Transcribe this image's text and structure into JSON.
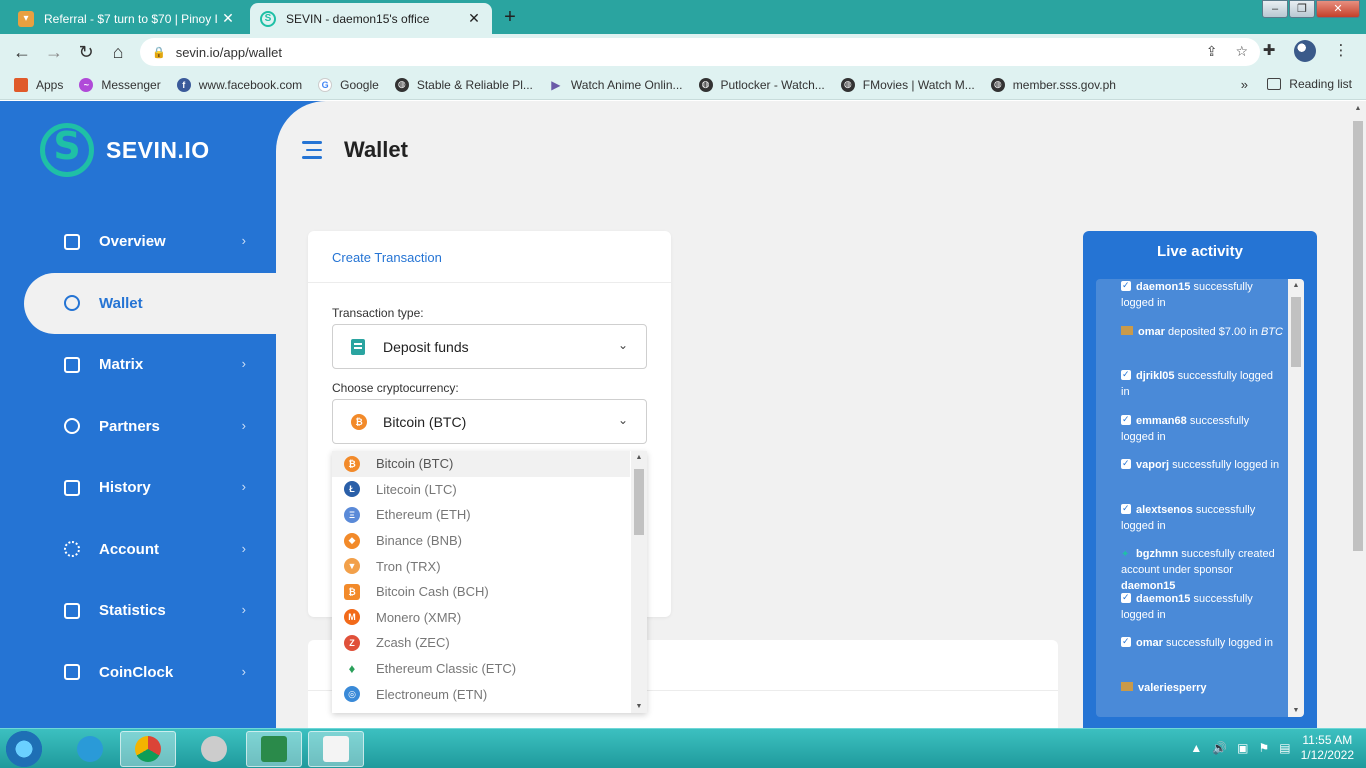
{
  "browser": {
    "tabs": [
      {
        "title": "Referral - $7 turn to $70 | Pinoy I",
        "active": false
      },
      {
        "title": "SEVIN - daemon15's office",
        "active": true
      }
    ],
    "new_tab": "+",
    "url": "sevin.io/app/wallet",
    "bookmarks": [
      {
        "label": "Apps",
        "icon": "apps-grid-icon",
        "color": "#e05a2a"
      },
      {
        "label": "Messenger",
        "icon": "messenger-icon",
        "color": "#b04ad8"
      },
      {
        "label": "www.facebook.com",
        "icon": "facebook-icon",
        "color": "#3a5a9a"
      },
      {
        "label": "Google",
        "icon": "google-icon",
        "color": "#4285f4"
      },
      {
        "label": "Stable & Reliable Pl...",
        "icon": "globe-icon",
        "color": "#333333"
      },
      {
        "label": "Watch Anime Onlin...",
        "icon": "play-icon",
        "color": "#6a5aa8"
      },
      {
        "label": "Putlocker - Watch...",
        "icon": "globe-icon",
        "color": "#333333"
      },
      {
        "label": "FMovies | Watch M...",
        "icon": "globe-icon",
        "color": "#333333"
      },
      {
        "label": "member.sss.gov.ph",
        "icon": "globe-icon",
        "color": "#333333"
      }
    ],
    "more_bookmarks": "»",
    "reading_list": "Reading list"
  },
  "sidebar": {
    "brand": "SEVIN.IO",
    "items": [
      {
        "label": "Overview",
        "icon": "briefcase-icon",
        "active": false
      },
      {
        "label": "Wallet",
        "icon": "coins-icon",
        "active": true
      },
      {
        "label": "Matrix",
        "icon": "list-icon",
        "active": false
      },
      {
        "label": "Partners",
        "icon": "users-icon",
        "active": false
      },
      {
        "label": "History",
        "icon": "folder-icon",
        "active": false
      },
      {
        "label": "Account",
        "icon": "gear-icon",
        "active": false
      },
      {
        "label": "Statistics",
        "icon": "chart-icon",
        "active": false
      },
      {
        "label": "CoinClock",
        "icon": "clock-grid-icon",
        "active": false
      }
    ]
  },
  "main": {
    "title": "Wallet",
    "create_transaction": {
      "heading": "Create Transaction",
      "type_label": "Transaction type:",
      "type_value": "Deposit funds",
      "crypto_label": "Choose cryptocurrency:",
      "crypto_value": "Bitcoin (BTC)"
    },
    "crypto_options": [
      {
        "label": "Bitcoin (BTC)",
        "color": "#f28a2a",
        "glyph": "₿"
      },
      {
        "label": "Litecoin (LTC)",
        "color": "#2a5fa8",
        "glyph": "Ł"
      },
      {
        "label": "Ethereum (ETH)",
        "color": "#5a8ad8",
        "glyph": "Ξ"
      },
      {
        "label": "Binance (BNB)",
        "color": "#f28a2a",
        "glyph": "◆"
      },
      {
        "label": "Tron (TRX)",
        "color": "#f2a04a",
        "glyph": "▼"
      },
      {
        "label": "Bitcoin Cash (BCH)",
        "color": "#f28a2a",
        "glyph": "₿"
      },
      {
        "label": "Monero (XMR)",
        "color": "#f26a1a",
        "glyph": "M"
      },
      {
        "label": "Zcash (ZEC)",
        "color": "#e0503a",
        "glyph": "Z"
      },
      {
        "label": "Ethereum Classic (ETC)",
        "color": "#2aa05a",
        "glyph": "♦"
      },
      {
        "label": "Electroneum (ETN)",
        "color": "#3a8ad8",
        "glyph": "◎"
      }
    ]
  },
  "live_activity": {
    "title": "Live activity",
    "items": [
      {
        "kind": "check",
        "user": "daemon15",
        "text": " successfully logged in",
        "suffix": ""
      },
      {
        "kind": "deposit",
        "user": "omar",
        "text": " deposited $7.00 in ",
        "suffix": "BTC"
      },
      {
        "kind": "check",
        "user": "djrikl05",
        "text": " successfully logged in",
        "suffix": ""
      },
      {
        "kind": "check",
        "user": "emman68",
        "text": " successfully logged in",
        "suffix": ""
      },
      {
        "kind": "check",
        "user": "vaporj",
        "text": " successfully logged in",
        "suffix": ""
      },
      {
        "kind": "check",
        "user": "alextsenos",
        "text": " successfully logged in",
        "suffix": ""
      },
      {
        "kind": "user",
        "user": "bgzhmn",
        "text": " succesfully created account under sponsor ",
        "suffix": "daemon15"
      },
      {
        "kind": "check",
        "user": "daemon15",
        "text": " successfully logged in",
        "suffix": ""
      },
      {
        "kind": "check",
        "user": "omar",
        "text": " successfully logged in",
        "suffix": ""
      },
      {
        "kind": "deposit",
        "user": "valeriesperry",
        "text": "",
        "suffix": ""
      }
    ]
  },
  "taskbar": {
    "time": "11:55 AM",
    "date": "1/12/2022"
  }
}
